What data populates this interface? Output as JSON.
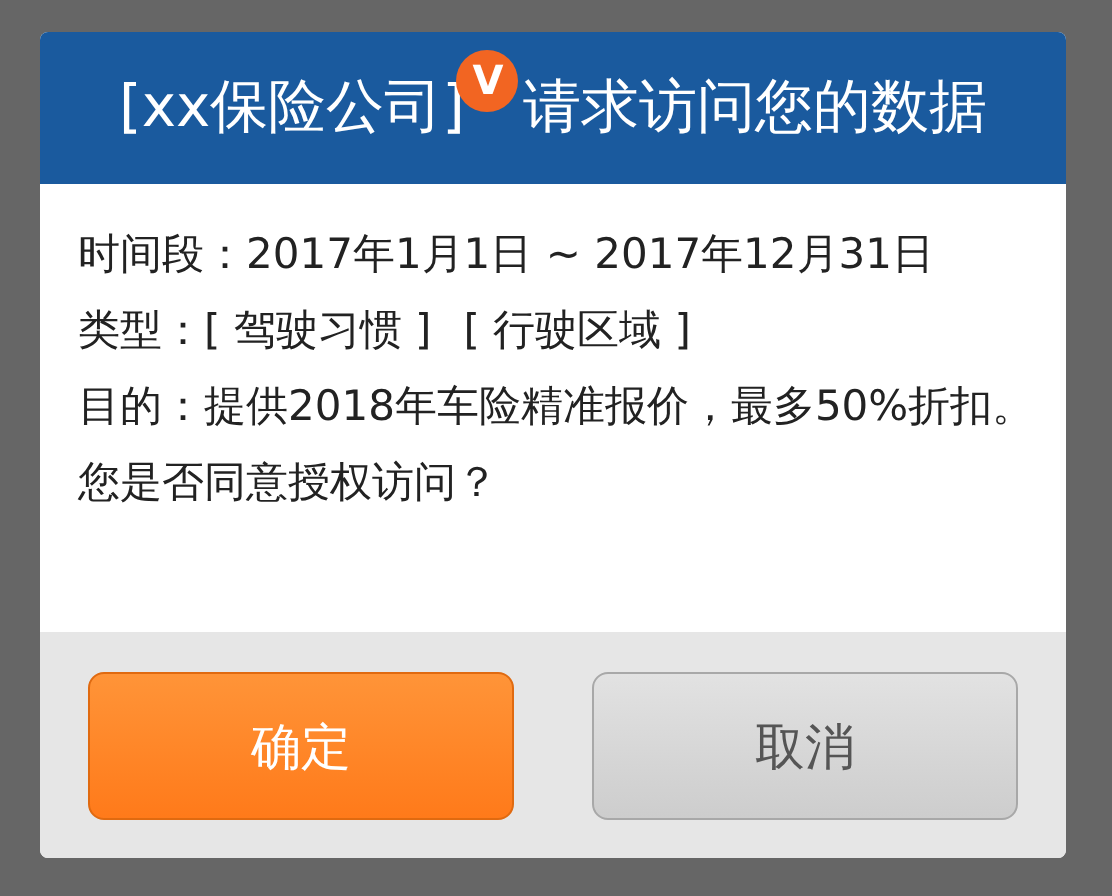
{
  "dialog": {
    "title": {
      "requester": "[xx保险公司]",
      "badge": "V",
      "text": "请求访问您的数据"
    },
    "rows": [
      {
        "kind": "text",
        "label": "时间段：",
        "value": "2017年1月1日 ~ 2017年12月31日"
      },
      {
        "kind": "tags",
        "label": "类型：",
        "tags": [
          "[ 驾驶习惯 ]",
          "[ 行驶区域 ]"
        ]
      },
      {
        "kind": "text",
        "label": "目的：",
        "value": "提供2018年车险精准报价，最多50%折扣。"
      }
    ],
    "question": "您是否同意授权访问？",
    "buttons": [
      {
        "label": "确定",
        "kind": "primary"
      },
      {
        "label": "取消",
        "kind": "secondary"
      }
    ]
  }
}
